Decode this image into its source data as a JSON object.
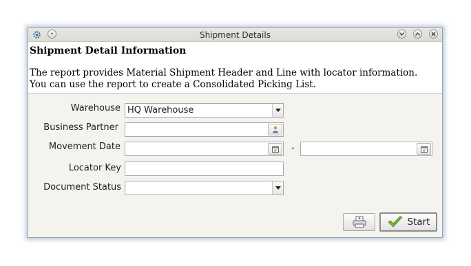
{
  "window": {
    "title": "Shipment Details",
    "title_icon": "gear-icon"
  },
  "header": {
    "title": "Shipment Detail Information",
    "description_line1": "The report provides Material Shipment Header and Line with locator information.",
    "description_line2": "You can use the report to create a Consolidated Picking List."
  },
  "form": {
    "warehouse": {
      "label": "Warehouse",
      "value": "HQ Warehouse"
    },
    "business_partner": {
      "label": "Business Partner",
      "value": ""
    },
    "movement_date": {
      "label": "Movement Date",
      "from_value": "",
      "separator": "-",
      "to_value": ""
    },
    "locator_key": {
      "label": "Locator Key",
      "value": ""
    },
    "document_status": {
      "label": "Document Status",
      "value": ""
    }
  },
  "buttons": {
    "start_label": "Start",
    "print_icon": "print-icon",
    "start_icon": "checkmark-icon"
  },
  "colors": {
    "checkmark": "#7bb038",
    "window_background": "#f5f3ee"
  }
}
